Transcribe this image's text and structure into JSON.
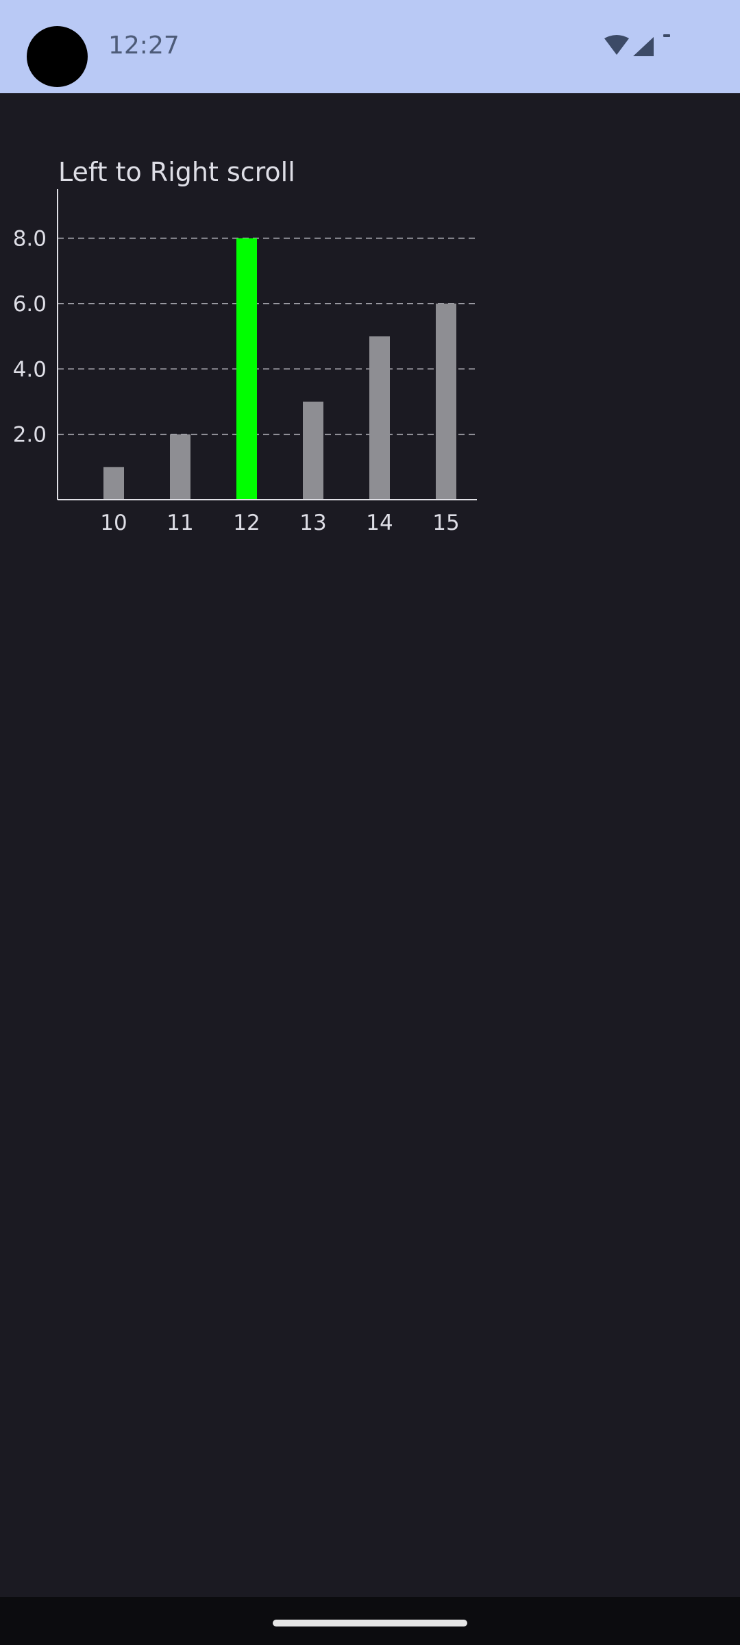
{
  "status_bar": {
    "time": "12:27",
    "icons": [
      "wifi-icon",
      "cellular-signal-icon",
      "battery-icon"
    ],
    "background": "#b9c9f5"
  },
  "colors": {
    "background": "#1b1a22",
    "bar_default": "#8e8e93",
    "bar_highlight": "#00ff00",
    "text": "#dedee6"
  },
  "chart_data": {
    "type": "bar",
    "title": "Left to Right scroll",
    "categories": [
      "10",
      "11",
      "12",
      "13",
      "14",
      "15"
    ],
    "values": [
      1,
      2,
      8,
      3,
      5,
      6
    ],
    "highlighted_category": "12",
    "xlabel": "",
    "ylabel": "",
    "ylim": [
      0,
      9.5
    ],
    "yticks": [
      2.0,
      4.0,
      6.0,
      8.0
    ],
    "ytick_labels": [
      "2.0",
      "4.0",
      "6.0",
      "8.0"
    ],
    "grid": "horizontal dashed",
    "legend": "none"
  }
}
